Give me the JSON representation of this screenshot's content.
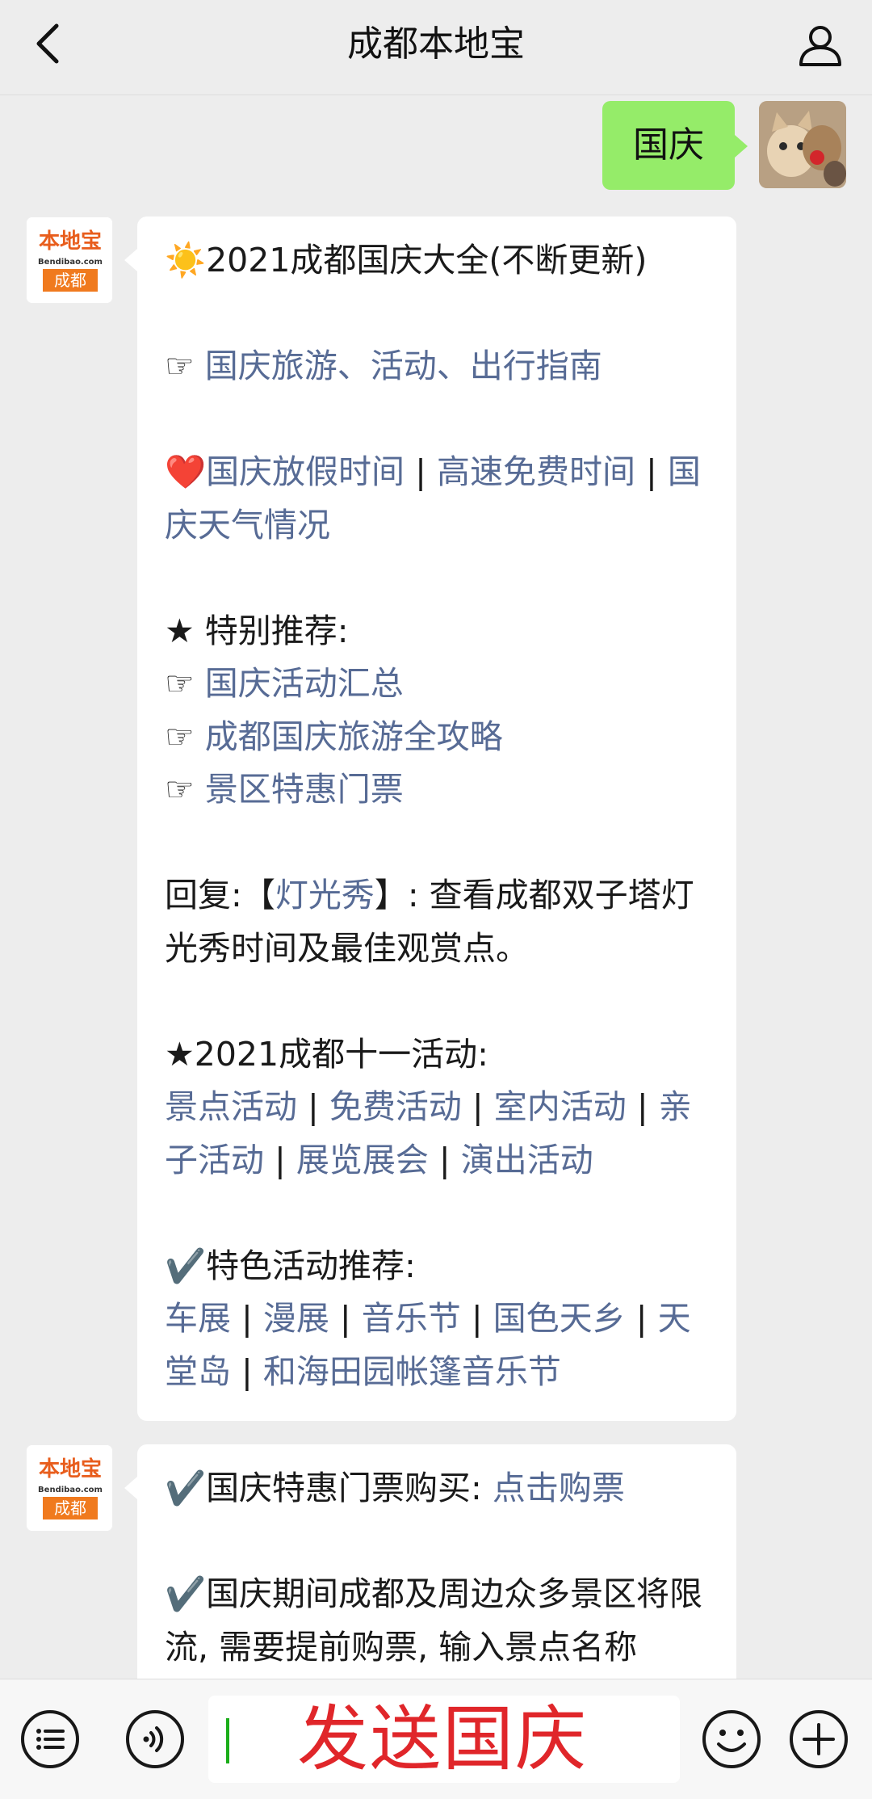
{
  "header": {
    "title": "成都本地宝"
  },
  "my_message": {
    "text": "国庆"
  },
  "bot": {
    "logo_top": "本地宝",
    "logo_mid": "Bendibao.com",
    "logo_bottom": "成都"
  },
  "message1": {
    "line_title": "2021成都国庆大全(不断更新)",
    "link_guide": "国庆旅游、活动、出行指南",
    "link_holiday": "国庆放假时间",
    "link_highway": "高速免费时间",
    "link_weather": "国庆天气情况",
    "special_heading": "★ 特别推荐:",
    "link_events": "国庆活动汇总",
    "link_tour": "成都国庆旅游全攻略",
    "link_tickets": "景区特惠门票",
    "reply_prefix": "回复:【",
    "reply_keyword": "灯光秀",
    "reply_suffix": "】: 查看成都双子塔灯光秀时间及最佳观赏点。",
    "activities_heading": "★2021成都十一活动:",
    "act_1": "景点活动",
    "act_2": "免费活动",
    "act_3": "室内活动",
    "act_4": "亲子活动",
    "act_5": "展览展会",
    "act_6": "演出活动",
    "featured_heading": "特色活动推荐:",
    "feat_1": "车展",
    "feat_2": "漫展",
    "feat_3": "音乐节",
    "feat_4": "国色天乡",
    "feat_5": "天堂岛",
    "feat_6": "和海田园帐篷音乐节",
    "separator": " | "
  },
  "message2": {
    "ticket_label": "国庆特惠门票购买: ",
    "ticket_link": "点击购票",
    "notice": "国庆期间成都及周边众多景区将限流, 需要提前购票, 输入景点名称"
  },
  "input": {
    "text": "发送国庆"
  },
  "colors": {
    "link": "#576b95",
    "my_bubble": "#95ec69",
    "typed_text": "#e0262a"
  }
}
